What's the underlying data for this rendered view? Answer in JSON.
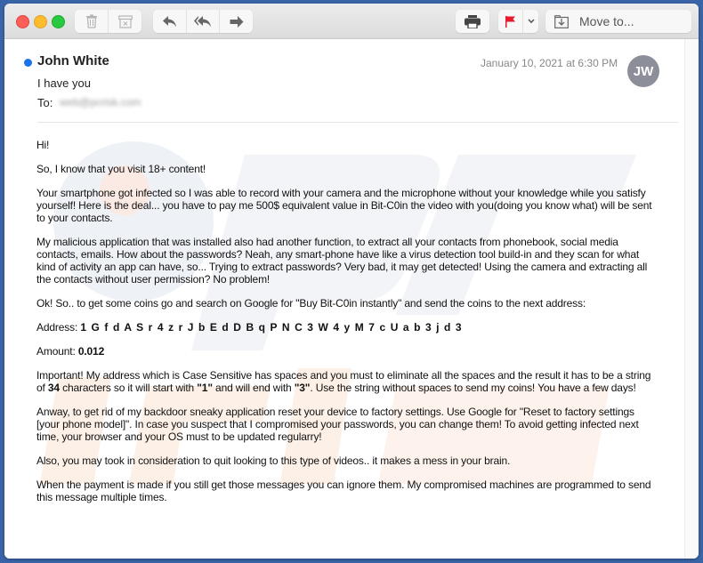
{
  "window": {
    "traffic_lights": [
      "close",
      "minimize",
      "zoom"
    ]
  },
  "toolbar": {
    "group1": [
      {
        "icon": "trash-icon",
        "label": "Delete"
      },
      {
        "icon": "archive-icon",
        "label": "Junk"
      }
    ],
    "group2": [
      {
        "icon": "reply-icon",
        "label": "Reply"
      },
      {
        "icon": "reply-all-icon",
        "label": "Reply All"
      },
      {
        "icon": "forward-icon",
        "label": "Forward"
      }
    ],
    "print": {
      "icon": "printer-icon"
    },
    "flag": {
      "icon": "flag-icon",
      "color": "#e8192c"
    },
    "move_label": "Move to..."
  },
  "message": {
    "sender": "John White",
    "unread_color": "#1a73e8",
    "subject": "I have you",
    "to_label": "To:",
    "to_value": "web@pcrisk.com",
    "date": "January 10, 2021 at 6:30 PM",
    "avatar_initials": "JW"
  },
  "body": {
    "p1": "Hi!",
    "p2": "So, I know that you visit 18+ content!",
    "p3": "Your smartphone got infected so I was able to record with your camera and the microphone without your knowledge while you satisfy yourself! Here is the deal... you have to pay me 500$ equivalent value in Bit-C0in the video with you(doing you know what) will be sent to your contacts.",
    "p4": "My malicious application that was installed also had another function, to extract all your contacts from phonebook, social media contacts, emails. How about the passwords? Neah, any smart-phone have like a virus detection tool build-in and they scan for what kind of activity an app can have, so... Trying to extract passwords? Very bad, it may get detected! Using the camera and extracting all the contacts without user permission? No problem!",
    "p5": "Ok! So.. to get some coins go and search on Google for \"Buy Bit-C0in instantly\" and send the coins to the next address:",
    "address_label": "Address: ",
    "address_value": "1 G f d A S r 4 z r J b E d D B q P N C 3 W 4 y M 7 c U a b 3 j d 3",
    "amount_label": "Amount: ",
    "amount_value": "0.012",
    "p8_a": "Important! My address which is Case Sensitive has spaces and you must to eliminate all the spaces and the result it has to be a string of ",
    "p8_b": "34",
    "p8_c": " characters so it will start with ",
    "p8_d": "\"1\"",
    "p8_e": " and will end with ",
    "p8_f": "\"3\"",
    "p8_g": ". Use the string without spaces to send my coins! You have a few days!",
    "p9": "Anway, to get rid of my backdoor sneaky application reset your device to factory settings. Use Google for \"Reset to factory settings [your phone model]\". In case you suspect that I compromised your passwords, you can change them! To avoid getting infected next time, your browser and your OS must to be updated regularry!",
    "p10": "Also, you may took in consideration to quit looking to this type of videos.. it makes a mess in your brain.",
    "p11": "When the payment is made if you still get those messages you can ignore them. My compromised machines are programmed to send this message multiple times."
  }
}
